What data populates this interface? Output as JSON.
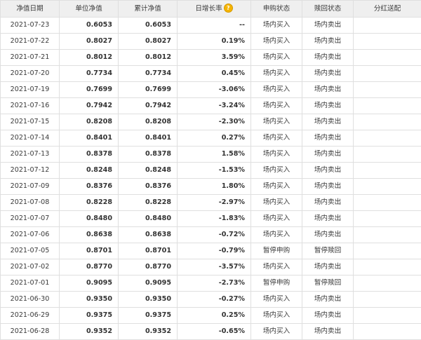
{
  "table": {
    "headers": {
      "date": "净值日期",
      "unit_nav": "单位净值",
      "acc_nav": "累计净值",
      "daily_rate": "日增长率",
      "daily_rate_help_icon": "question-icon",
      "purchase_status": "申购状态",
      "redeem_status": "赎回状态",
      "dividend": "分红送配"
    },
    "colors": {
      "up": "#e0262c",
      "down": "#1a9b3a",
      "header_bg": "#efefef"
    },
    "rows": [
      {
        "date": "2021-07-23",
        "unit": "0.6053",
        "acc": "0.6053",
        "rate": "--",
        "dir": "flat",
        "buy": "场内买入",
        "sell": "场内卖出",
        "div": ""
      },
      {
        "date": "2021-07-22",
        "unit": "0.8027",
        "acc": "0.8027",
        "rate": "0.19%",
        "dir": "up",
        "buy": "场内买入",
        "sell": "场内卖出",
        "div": ""
      },
      {
        "date": "2021-07-21",
        "unit": "0.8012",
        "acc": "0.8012",
        "rate": "3.59%",
        "dir": "up",
        "buy": "场内买入",
        "sell": "场内卖出",
        "div": ""
      },
      {
        "date": "2021-07-20",
        "unit": "0.7734",
        "acc": "0.7734",
        "rate": "0.45%",
        "dir": "up",
        "buy": "场内买入",
        "sell": "场内卖出",
        "div": ""
      },
      {
        "date": "2021-07-19",
        "unit": "0.7699",
        "acc": "0.7699",
        "rate": "-3.06%",
        "dir": "down",
        "buy": "场内买入",
        "sell": "场内卖出",
        "div": ""
      },
      {
        "date": "2021-07-16",
        "unit": "0.7942",
        "acc": "0.7942",
        "rate": "-3.24%",
        "dir": "down",
        "buy": "场内买入",
        "sell": "场内卖出",
        "div": ""
      },
      {
        "date": "2021-07-15",
        "unit": "0.8208",
        "acc": "0.8208",
        "rate": "-2.30%",
        "dir": "down",
        "buy": "场内买入",
        "sell": "场内卖出",
        "div": ""
      },
      {
        "date": "2021-07-14",
        "unit": "0.8401",
        "acc": "0.8401",
        "rate": "0.27%",
        "dir": "up",
        "buy": "场内买入",
        "sell": "场内卖出",
        "div": ""
      },
      {
        "date": "2021-07-13",
        "unit": "0.8378",
        "acc": "0.8378",
        "rate": "1.58%",
        "dir": "up",
        "buy": "场内买入",
        "sell": "场内卖出",
        "div": ""
      },
      {
        "date": "2021-07-12",
        "unit": "0.8248",
        "acc": "0.8248",
        "rate": "-1.53%",
        "dir": "down",
        "buy": "场内买入",
        "sell": "场内卖出",
        "div": ""
      },
      {
        "date": "2021-07-09",
        "unit": "0.8376",
        "acc": "0.8376",
        "rate": "1.80%",
        "dir": "up",
        "buy": "场内买入",
        "sell": "场内卖出",
        "div": ""
      },
      {
        "date": "2021-07-08",
        "unit": "0.8228",
        "acc": "0.8228",
        "rate": "-2.97%",
        "dir": "down",
        "buy": "场内买入",
        "sell": "场内卖出",
        "div": ""
      },
      {
        "date": "2021-07-07",
        "unit": "0.8480",
        "acc": "0.8480",
        "rate": "-1.83%",
        "dir": "down",
        "buy": "场内买入",
        "sell": "场内卖出",
        "div": ""
      },
      {
        "date": "2021-07-06",
        "unit": "0.8638",
        "acc": "0.8638",
        "rate": "-0.72%",
        "dir": "down",
        "buy": "场内买入",
        "sell": "场内卖出",
        "div": ""
      },
      {
        "date": "2021-07-05",
        "unit": "0.8701",
        "acc": "0.8701",
        "rate": "-0.79%",
        "dir": "down",
        "buy": "暂停申购",
        "sell": "暂停赎回",
        "div": ""
      },
      {
        "date": "2021-07-02",
        "unit": "0.8770",
        "acc": "0.8770",
        "rate": "-3.57%",
        "dir": "down",
        "buy": "场内买入",
        "sell": "场内卖出",
        "div": ""
      },
      {
        "date": "2021-07-01",
        "unit": "0.9095",
        "acc": "0.9095",
        "rate": "-2.73%",
        "dir": "down",
        "buy": "暂停申购",
        "sell": "暂停赎回",
        "div": ""
      },
      {
        "date": "2021-06-30",
        "unit": "0.9350",
        "acc": "0.9350",
        "rate": "-0.27%",
        "dir": "down",
        "buy": "场内买入",
        "sell": "场内卖出",
        "div": ""
      },
      {
        "date": "2021-06-29",
        "unit": "0.9375",
        "acc": "0.9375",
        "rate": "0.25%",
        "dir": "up",
        "buy": "场内买入",
        "sell": "场内卖出",
        "div": ""
      },
      {
        "date": "2021-06-28",
        "unit": "0.9352",
        "acc": "0.9352",
        "rate": "-0.65%",
        "dir": "down",
        "buy": "场内买入",
        "sell": "场内卖出",
        "div": ""
      }
    ]
  }
}
